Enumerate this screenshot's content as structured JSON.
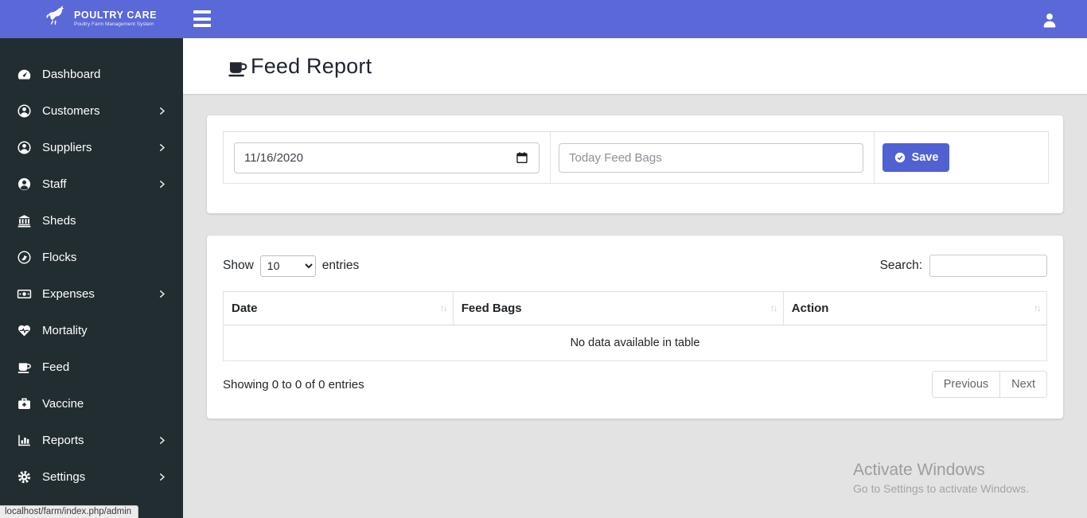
{
  "header": {
    "brand_title": "POULTRY CARE",
    "brand_subtitle": "Poultry Farm Management System"
  },
  "sidebar": {
    "items": [
      {
        "label": "Dashboard",
        "icon": "tachometer-icon",
        "has_submenu": false
      },
      {
        "label": "Customers",
        "icon": "user-circle-icon",
        "has_submenu": true
      },
      {
        "label": "Suppliers",
        "icon": "user-circle-icon",
        "has_submenu": true
      },
      {
        "label": "Staff",
        "icon": "user-solid-circle-icon",
        "has_submenu": true
      },
      {
        "label": "Sheds",
        "icon": "bank-icon",
        "has_submenu": false
      },
      {
        "label": "Flocks",
        "icon": "bird-circle-icon",
        "has_submenu": false
      },
      {
        "label": "Expenses",
        "icon": "money-bill-icon",
        "has_submenu": true
      },
      {
        "label": "Mortality",
        "icon": "heartbeat-icon",
        "has_submenu": false
      },
      {
        "label": "Feed",
        "icon": "mug-icon",
        "has_submenu": false
      },
      {
        "label": "Vaccine",
        "icon": "medkit-icon",
        "has_submenu": false
      },
      {
        "label": "Reports",
        "icon": "bar-chart-icon",
        "has_submenu": true
      },
      {
        "label": "Settings",
        "icon": "gear-icon",
        "has_submenu": true
      }
    ]
  },
  "page": {
    "title": "Feed Report"
  },
  "form": {
    "date_value": "11/16/2020",
    "feed_bags_placeholder": "Today Feed Bags",
    "save_label": "Save"
  },
  "table": {
    "show_label": "Show",
    "entries_label": "entries",
    "page_length": "10",
    "search_label": "Search:",
    "columns": {
      "date": "Date",
      "feed_bags": "Feed Bags",
      "action": "Action"
    },
    "sort_glyphs": "↑↓",
    "empty_message": "No data available in table",
    "info": "Showing 0 to 0 of 0 entries",
    "pagination": {
      "previous": "Previous",
      "next": "Next"
    },
    "rows": []
  },
  "watermark": {
    "line1": "Activate Windows",
    "line2": "Go to Settings to activate Windows."
  },
  "status_bar": {
    "text": "localhost/farm/index.php/admin"
  },
  "colors": {
    "header": "#5a68d8",
    "sidebar": "#222d32",
    "save_button": "#5062d2",
    "content_bg": "#e3e3e3"
  }
}
